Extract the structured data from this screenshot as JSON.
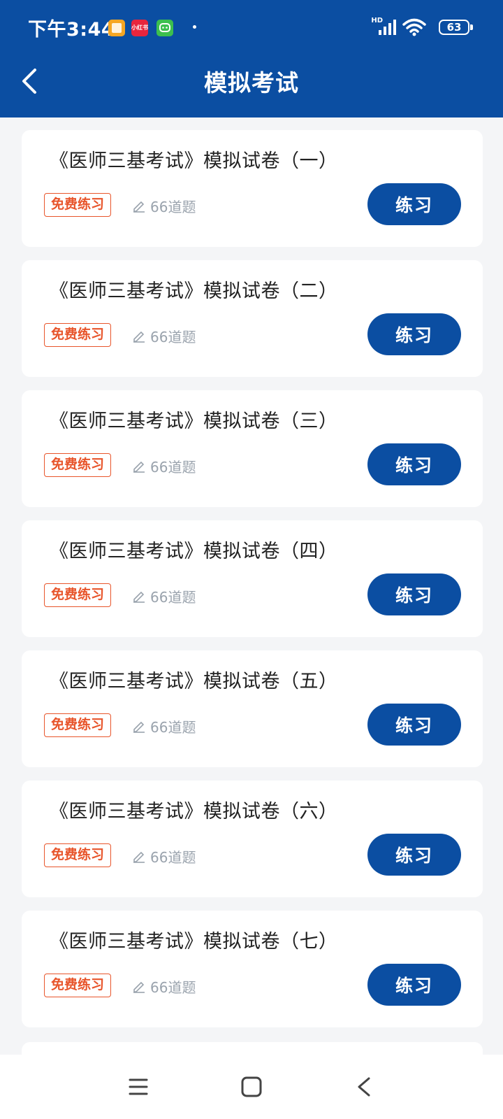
{
  "status_bar": {
    "time": "下午3:44",
    "apps": [
      {
        "icon": "notes-app-icon",
        "label": "",
        "color": "#f5a623"
      },
      {
        "icon": "xiaohongshu-app-icon",
        "label": "小红书",
        "color": "#e8253d"
      },
      {
        "icon": "chat-app-icon",
        "label": "",
        "color": "#3cbf4e"
      }
    ],
    "network": "HD",
    "battery": "63"
  },
  "header": {
    "title": "模拟考试",
    "background": "#0b4ea2"
  },
  "exams": [
    {
      "title": "《医师三基考试》模拟试卷（一）",
      "tag": "免费练习",
      "count": "66道题",
      "button": "练习"
    },
    {
      "title": "《医师三基考试》模拟试卷（二）",
      "tag": "免费练习",
      "count": "66道题",
      "button": "练习"
    },
    {
      "title": "《医师三基考试》模拟试卷（三）",
      "tag": "免费练习",
      "count": "66道题",
      "button": "练习"
    },
    {
      "title": "《医师三基考试》模拟试卷（四）",
      "tag": "免费练习",
      "count": "66道题",
      "button": "练习"
    },
    {
      "title": "《医师三基考试》模拟试卷（五）",
      "tag": "免费练习",
      "count": "66道题",
      "button": "练习"
    },
    {
      "title": "《医师三基考试》模拟试卷（六）",
      "tag": "免费练习",
      "count": "66道题",
      "button": "练习"
    },
    {
      "title": "《医师三基考试》模拟试卷（七）",
      "tag": "免费练习",
      "count": "66道题",
      "button": "练习"
    }
  ],
  "colors": {
    "accent": "#0b4ea2",
    "tag": "#e8552b",
    "muted": "#9aa3ad"
  },
  "nav_bar": {
    "buttons": [
      "menu-icon",
      "home-icon",
      "back-icon"
    ]
  }
}
